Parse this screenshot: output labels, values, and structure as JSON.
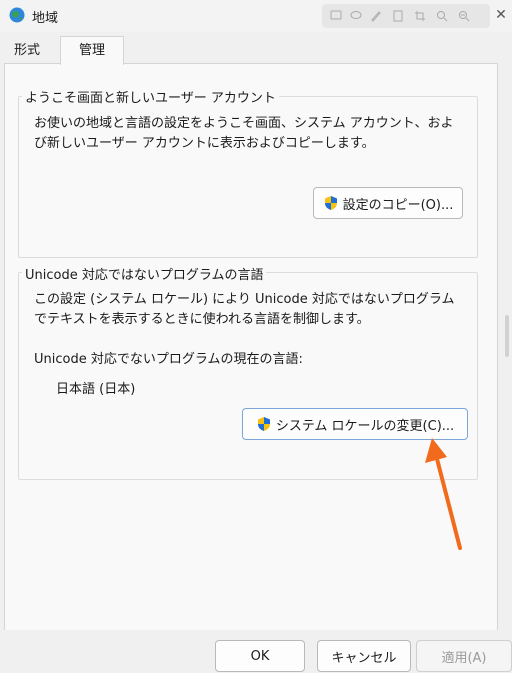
{
  "window": {
    "title": "地域",
    "close_glyph": "✕"
  },
  "tabs": [
    {
      "label": "形式",
      "selected": false
    },
    {
      "label": "管理",
      "selected": true
    }
  ],
  "welcome": {
    "legend": "ようこそ画面と新しいユーザー アカウント",
    "description": "お使いの地域と言語の設定をようこそ画面、システム アカウント、および新しいユーザー アカウントに表示およびコピーします。",
    "copy_button": "設定のコピー(O)..."
  },
  "unicode": {
    "legend": "Unicode 対応ではないプログラムの言語",
    "description": "この設定 (システム ロケール) により Unicode 対応ではないプログラムでテキストを表示するときに使われる言語を制御します。",
    "current_label": "Unicode 対応でないプログラムの現在の言語:",
    "current_value": "日本語 (日本)",
    "change_button": "システム ロケールの変更(C)..."
  },
  "footer": {
    "ok": "OK",
    "cancel": "キャンセル",
    "apply": "適用(A)"
  },
  "colors": {
    "arrow": "#f26a1b",
    "shield_blue": "#1f6fd6",
    "shield_yellow": "#f5c211"
  }
}
